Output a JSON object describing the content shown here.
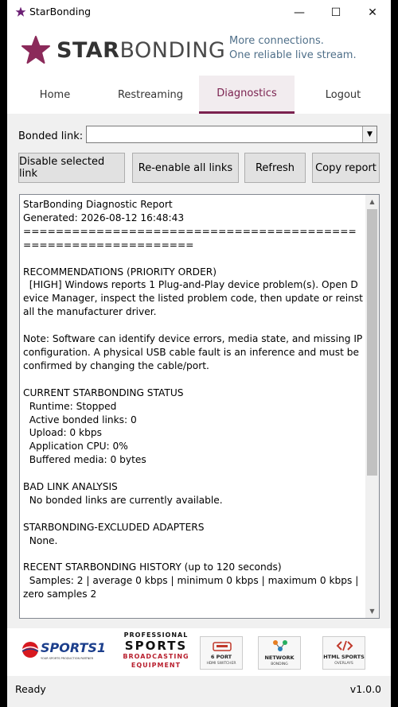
{
  "window": {
    "title": "StarBonding",
    "controls": {
      "minimize": "—",
      "maximize": "☐",
      "close": "✕"
    }
  },
  "brand": {
    "name_bold": "STAR",
    "name_light": "BONDING",
    "tagline_1": "More connections.",
    "tagline_2": "One reliable live stream.",
    "accent": "#8b2a5a"
  },
  "tabs": [
    {
      "label": "Home",
      "active": false
    },
    {
      "label": "Restreaming",
      "active": false
    },
    {
      "label": "Diagnostics",
      "active": true
    },
    {
      "label": "Logout",
      "active": false
    }
  ],
  "diagnostics": {
    "bonded_link_label": "Bonded link:",
    "bonded_link_value": "",
    "buttons": {
      "disable": "Disable selected link",
      "reenable": "Re-enable all links",
      "refresh": "Refresh",
      "copy": "Copy report"
    },
    "report": "StarBonding Diagnostic Report\nGenerated: 2026-08-12 16:48:43\n==============================================================\n\nRECOMMENDATIONS (PRIORITY ORDER)\n  [HIGH] Windows reports 1 Plug-and-Play device problem(s). Open Device Manager, inspect the listed problem code, then update or reinstall the manufacturer driver.\n\nNote: Software can identify device errors, media state, and missing IP configuration. A physical USB cable fault is an inference and must be confirmed by changing the cable/port.\n\nCURRENT STARBONDING STATUS\n  Runtime: Stopped\n  Active bonded links: 0\n  Upload: 0 kbps\n  Application CPU: 0%\n  Buffered media: 0 bytes\n\nBAD LINK ANALYSIS\n  No bonded links are currently available.\n\nSTARBONDING-EXCLUDED ADAPTERS\n  None.\n\nRECENT STARBONDING HISTORY (up to 120 seconds)\n  Samples: 2 | average 0 kbps | minimum 0 kbps | maximum 0 kbps | zero samples 2"
  },
  "sponsors": {
    "sports1": {
      "name": "SPORTS1",
      "sub": "YOUR SPORTS PRODUCTION PARTNER"
    },
    "pro": {
      "l1": "PROFESSIONAL",
      "l2": "SPORTS",
      "l3": "BROADCASTING",
      "l4": "EQUIPMENT"
    },
    "hdmi": {
      "title": "6 PORT",
      "sub": "HDMI SWITCHER"
    },
    "network": {
      "title": "NETWORK",
      "sub": "BONDING"
    },
    "overlays": {
      "title": "HTML SPORTS",
      "sub": "OVERLAYS"
    }
  },
  "status": {
    "text": "Ready",
    "version": "v1.0.0"
  }
}
